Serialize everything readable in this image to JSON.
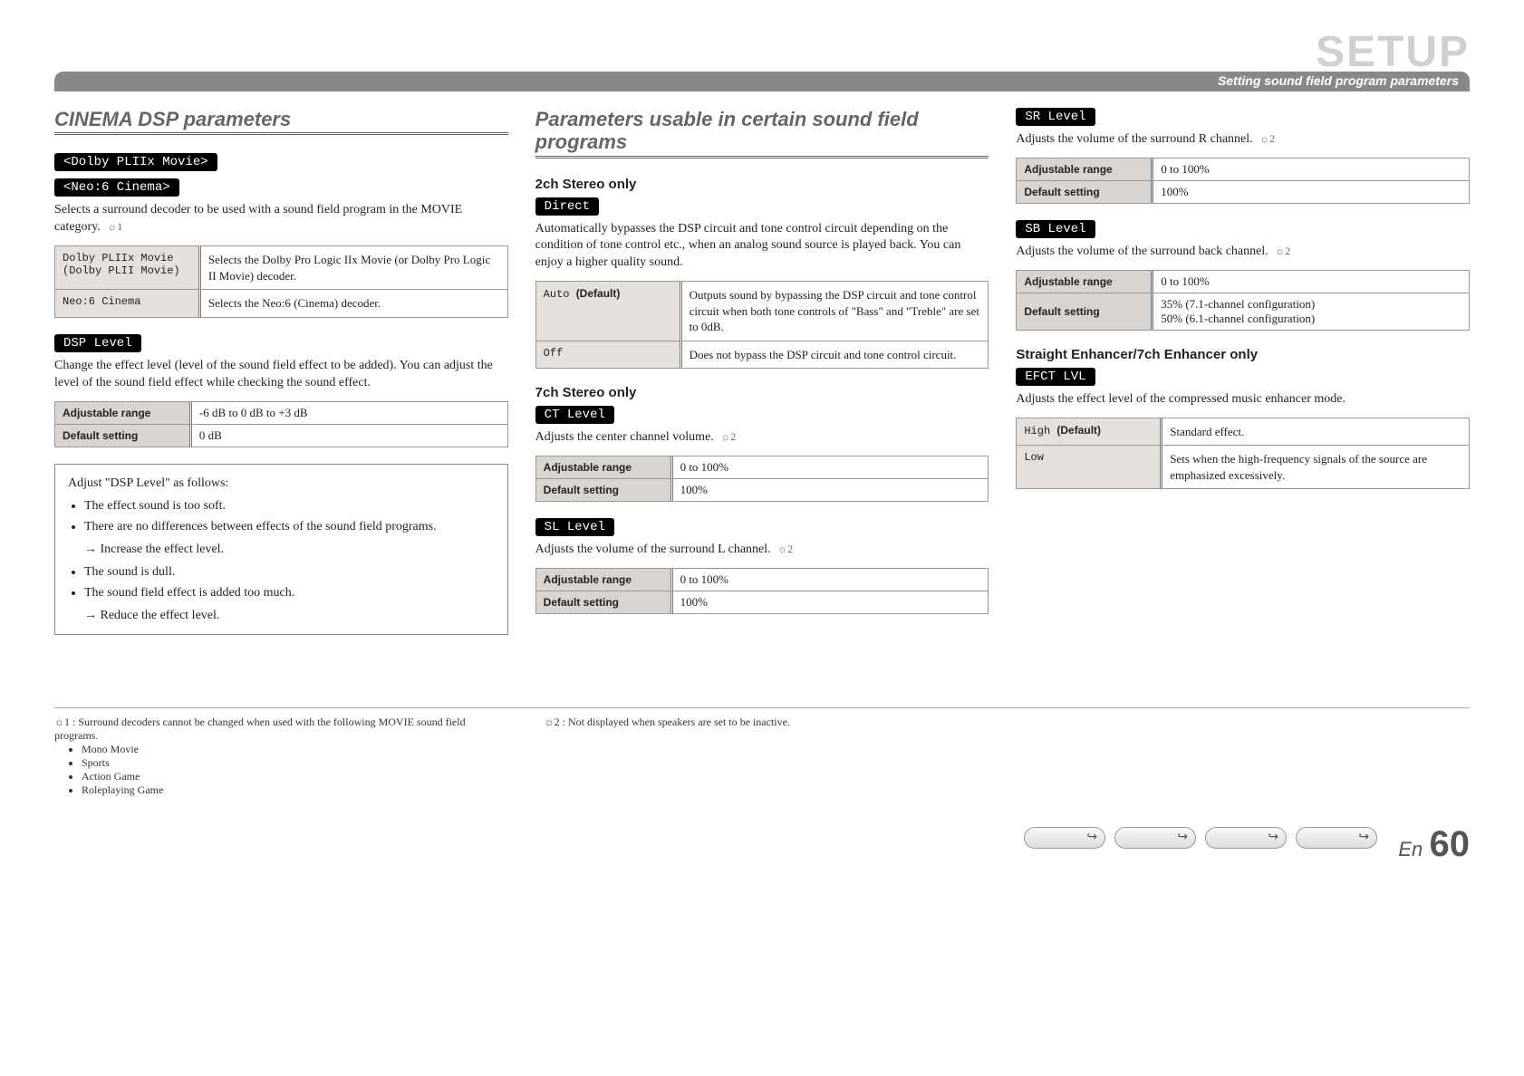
{
  "header": {
    "big_title": "SETUP",
    "subtitle": "Setting sound field program parameters"
  },
  "col1": {
    "title": "CINEMA DSP parameters",
    "dolby_pill": "<Dolby PLIIx Movie>",
    "neo_pill": "<Neo:6 Cinema>",
    "decoder_desc": "Selects a surround decoder to be used with a sound field program in the MOVIE category.",
    "decoder_note_ref": "☼1",
    "decoder_table": [
      {
        "k": "Dolby PLIIx Movie (Dolby PLII Movie)",
        "v": "Selects the Dolby Pro Logic IIx Movie (or Dolby Pro Logic II Movie) decoder."
      },
      {
        "k": "Neo:6 Cinema",
        "v": "Selects the Neo:6 (Cinema) decoder."
      }
    ],
    "dsp_pill": "DSP Level",
    "dsp_desc": "Change the effect level (level of the sound field effect to be added). You can adjust the level of the sound field effect while checking the sound effect.",
    "dsp_range_label": "Adjustable range",
    "dsp_range_value": "-6 dB to 0 dB to +3 dB",
    "dsp_default_label": "Default setting",
    "dsp_default_value": "0 dB",
    "guide_title": "Adjust \"DSP Level\" as follows:",
    "guide_items": [
      "The effect sound is too soft.",
      "There are no differences between effects of the sound field programs."
    ],
    "guide_arrow1": "→ Increase the effect level.",
    "guide_items2": [
      "The sound is dull.",
      "The sound field effect is added too much."
    ],
    "guide_arrow2": "→ Reduce the effect level."
  },
  "col2": {
    "title": "Parameters usable in certain sound field programs",
    "s1_heading": "2ch Stereo only",
    "s1_pill": "Direct",
    "s1_desc": "Automatically bypasses the DSP circuit and tone control circuit depending on the condition of tone control etc., when an analog sound source is played back. You can enjoy a higher quality sound.",
    "s1_table": [
      {
        "k": "Auto",
        "default": "(Default)",
        "v": "Outputs sound by bypassing the DSP circuit and tone control circuit when both tone controls of \"Bass\" and \"Treble\" are set to 0dB."
      },
      {
        "k": "Off",
        "default": "",
        "v": "Does not bypass the DSP circuit and tone control circuit."
      }
    ],
    "s2_heading": "7ch Stereo only",
    "ct_pill": "CT Level",
    "ct_desc": "Adjusts the center channel volume.",
    "ct_note_ref": "☼2",
    "ct_range_label": "Adjustable range",
    "ct_range_value": "0 to 100%",
    "ct_default_label": "Default setting",
    "ct_default_value": "100%",
    "sl_pill": "SL Level",
    "sl_desc": "Adjusts the volume of the surround L channel.",
    "sl_note_ref": "☼2",
    "sl_range_label": "Adjustable range",
    "sl_range_value": "0 to 100%",
    "sl_default_label": "Default setting",
    "sl_default_value": "100%"
  },
  "col3": {
    "sr_pill": "SR Level",
    "sr_desc": "Adjusts the volume of the surround R channel.",
    "sr_note_ref": "☼2",
    "sr_range_label": "Adjustable range",
    "sr_range_value": "0 to 100%",
    "sr_default_label": "Default setting",
    "sr_default_value": "100%",
    "sb_pill": "SB Level",
    "sb_desc": "Adjusts the volume of the surround back channel.",
    "sb_note_ref": "☼2",
    "sb_range_label": "Adjustable range",
    "sb_range_value": "0 to 100%",
    "sb_default_label": "Default setting",
    "sb_default_value_line1": "35% (7.1-channel configuration)",
    "sb_default_value_line2": "50% (6.1-channel configuration)",
    "enh_heading": "Straight Enhancer/7ch Enhancer only",
    "efct_pill": "EFCT LVL",
    "efct_desc": "Adjusts the effect level of the compressed music enhancer mode.",
    "efct_table": [
      {
        "k": "High",
        "default": "(Default)",
        "v": "Standard effect."
      },
      {
        "k": "Low",
        "default": "",
        "v": "Sets when the high-frequency signals of the source are emphasized excessively."
      }
    ]
  },
  "footnotes": {
    "n1_label": "☼1 :",
    "n1_text": "Surround decoders cannot be changed when used with the following MOVIE sound field programs.",
    "n1_items": [
      "Mono Movie",
      "Sports",
      "Action Game",
      "Roleplaying Game"
    ],
    "n2_label": "☼2 :",
    "n2_text": "Not displayed when speakers are set to be inactive."
  },
  "footer": {
    "lang": "En",
    "page": "60"
  }
}
